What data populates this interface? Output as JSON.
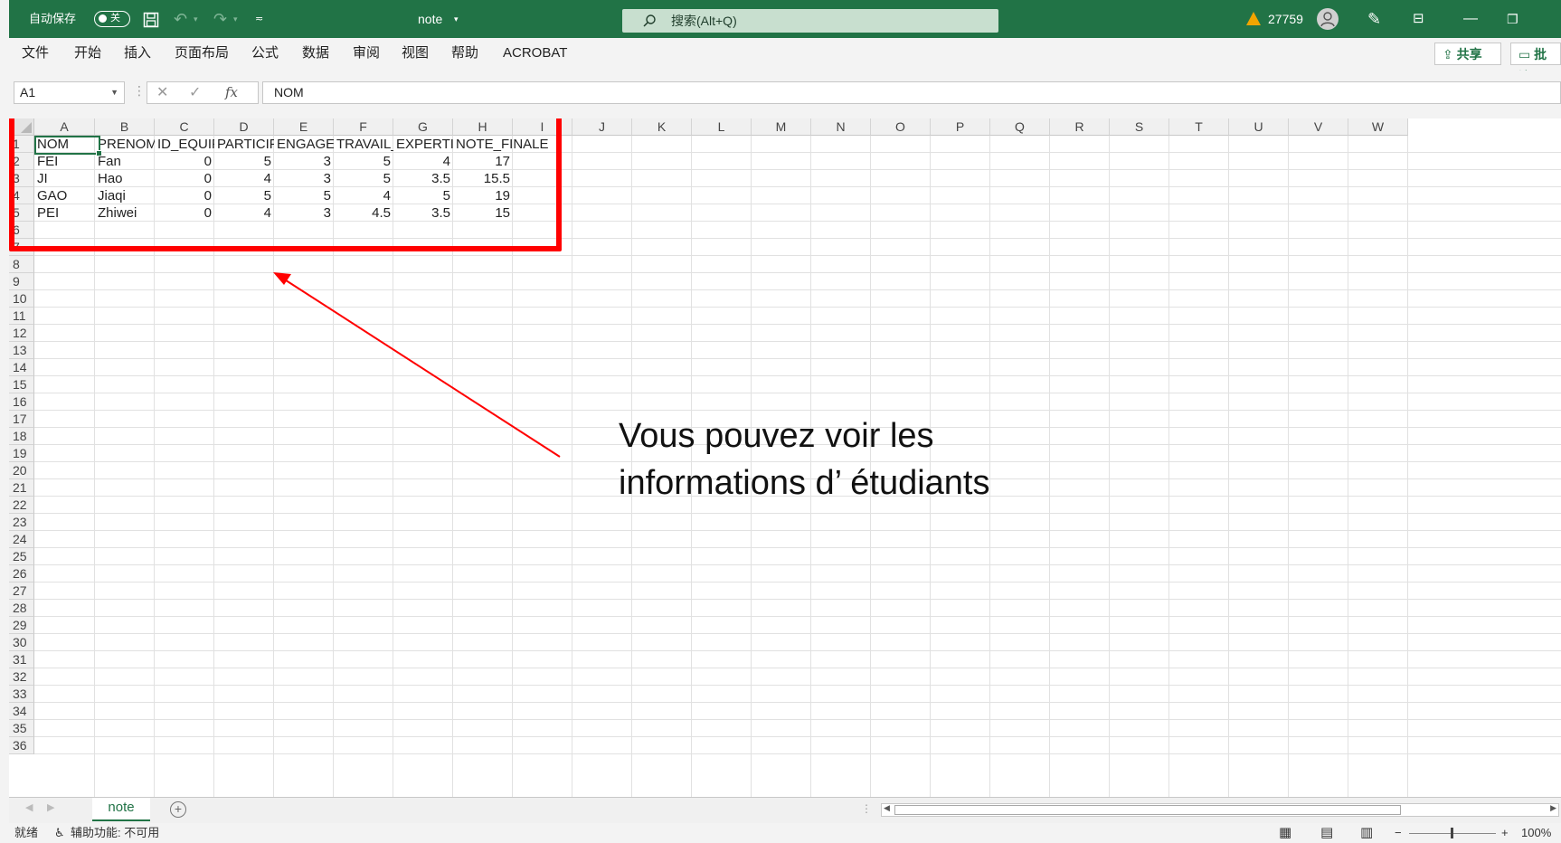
{
  "titlebar": {
    "autosave_label": "自动保存",
    "autosave_state": "关",
    "filename": "note",
    "search_placeholder": "搜索(Alt+Q)",
    "warning_count": "27759"
  },
  "menu": {
    "items": [
      "文件",
      "开始",
      "插入",
      "页面布局",
      "公式",
      "数据",
      "审阅",
      "视图",
      "帮助",
      "ACROBAT"
    ],
    "share_label": "共享",
    "comments_label": "批注"
  },
  "formula_bar": {
    "name_box": "A1",
    "fx_label": "fx",
    "formula": "NOM"
  },
  "grid": {
    "columns": [
      "A",
      "B",
      "C",
      "D",
      "E",
      "F",
      "G",
      "H",
      "I",
      "J",
      "K",
      "L",
      "M",
      "N",
      "O",
      "P",
      "Q",
      "R",
      "S",
      "T",
      "U",
      "V",
      "W"
    ],
    "row_numbers": [
      "1",
      "2",
      "3",
      "4",
      "5",
      "6",
      "7",
      "8",
      "9",
      "10",
      "11",
      "12",
      "13",
      "14",
      "15",
      "16",
      "17",
      "18",
      "19",
      "20",
      "21",
      "22",
      "23",
      "24",
      "25",
      "26",
      "27",
      "28",
      "29",
      "30",
      "31",
      "32",
      "33",
      "34",
      "35",
      "36"
    ],
    "header_row": [
      "NOM",
      "PRENOM",
      "ID_EQUIPE",
      "PARTICIPATION",
      "ENGAGEMENT",
      "TRAVAIL_EQUIPE",
      "EXPERTISE",
      "NOTE_FINALE"
    ],
    "rows": [
      [
        "FEI",
        "Fan",
        "0",
        "5",
        "3",
        "5",
        "4",
        "17"
      ],
      [
        "JI",
        "Hao",
        "0",
        "4",
        "3",
        "5",
        "3.5",
        "15.5"
      ],
      [
        "GAO",
        "Jiaqi",
        "0",
        "5",
        "5",
        "4",
        "5",
        "19"
      ],
      [
        "PEI",
        "Zhiwei",
        "0",
        "4",
        "3",
        "4.5",
        "3.5",
        "15"
      ]
    ]
  },
  "annotation": {
    "line1": "Vous pouvez voir les",
    "line2": "informations d’ étudiants"
  },
  "sheets": {
    "active": "note"
  },
  "status": {
    "ready": "就绪",
    "accessibility": "辅助功能: 不可用",
    "zoom": "100%"
  },
  "colors": {
    "excel_green": "#217346",
    "highlight_red": "#ff0000"
  }
}
